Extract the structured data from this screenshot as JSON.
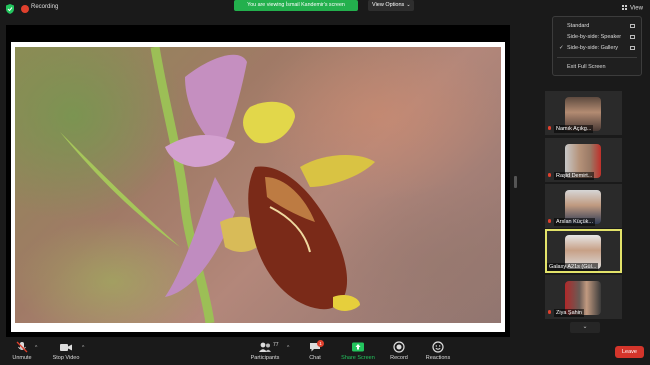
{
  "topbar": {
    "recording_label": "Recording",
    "viewing_banner": "You are viewing İsmail Kandemir's screen",
    "view_options_label": "View Options",
    "view_label": "View"
  },
  "menu": {
    "items": [
      {
        "label": "Standard",
        "checked": false
      },
      {
        "label": "Side-by-side: Speaker",
        "checked": false
      },
      {
        "label": "Side-by-side: Gallery",
        "checked": true
      },
      {
        "label": "Exit Full Screen",
        "checked": false
      }
    ],
    "check_glyph": "✓"
  },
  "participants": [
    {
      "name": "Namık Açıkg...",
      "muted": true,
      "active": false
    },
    {
      "name": "Raşid Demirt...",
      "muted": true,
      "active": false
    },
    {
      "name": "Arslan Küçük...",
      "muted": true,
      "active": false
    },
    {
      "name": "Galaxy A21s (Gül...",
      "muted": false,
      "active": true
    },
    {
      "name": "Ziya Şahin",
      "muted": true,
      "active": false
    }
  ],
  "toolbar": {
    "unmute": "Unmute",
    "stop_video": "Stop Video",
    "participants": "Participants",
    "participants_count": "77",
    "chat": "Chat",
    "chat_badge": "1",
    "share_screen": "Share Screen",
    "record": "Record",
    "reactions": "Reactions",
    "leave": "Leave"
  },
  "colors": {
    "banner_green": "#23b04d",
    "leave_red": "#d4352b",
    "active_tile_border": "#e3e36a",
    "mute_red": "#e0402d"
  }
}
